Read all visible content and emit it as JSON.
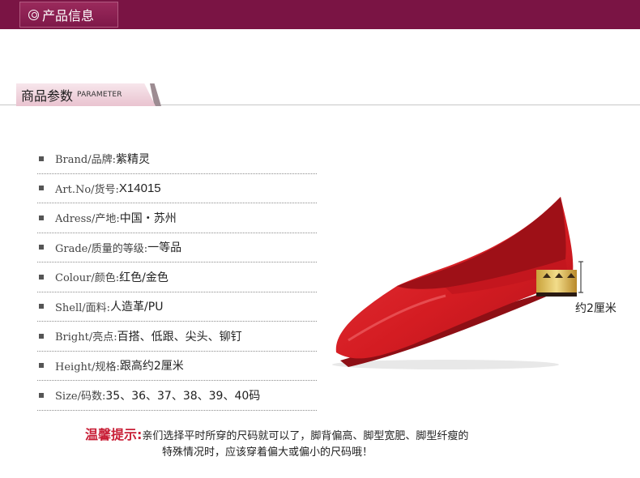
{
  "header": {
    "title": "产品信息"
  },
  "section": {
    "title_zh": "商品参数",
    "title_en": "PARAMETER"
  },
  "specs": [
    {
      "label": "Brand/品牌:",
      "value": "紫精灵"
    },
    {
      "label": "Art.No/货号:",
      "value": "X14015"
    },
    {
      "label": "Adress/产地:",
      "value": "中国・苏州"
    },
    {
      "label": "Grade/质量的等级:",
      "value": "一等品"
    },
    {
      "label": "Colour/颜色:",
      "value": "红色/金色"
    },
    {
      "label": "Shell/面料:",
      "value": "人造革/PU"
    },
    {
      "label": "Bright/亮点:",
      "value": "百搭、低跟、尖头、铆钉"
    },
    {
      "label": "Height/规格:",
      "value": "跟高约2厘米"
    },
    {
      "label": "Size/码数:",
      "value": "35、36、37、38、39、40码"
    }
  ],
  "product": {
    "heel_height_label": "约2厘米",
    "shoe_color": "#d61a22"
  },
  "tip": {
    "title": "温馨提示:",
    "line1": "亲们选择平时所穿的尺码就可以了，脚背偏高、脚型宽肥、脚型纤瘦的",
    "line2": "特殊情况时，应该穿着偏大或偏小的尺码哦！"
  },
  "colors": {
    "header_bg": "#7a1444",
    "accent_red": "#c81e36"
  }
}
